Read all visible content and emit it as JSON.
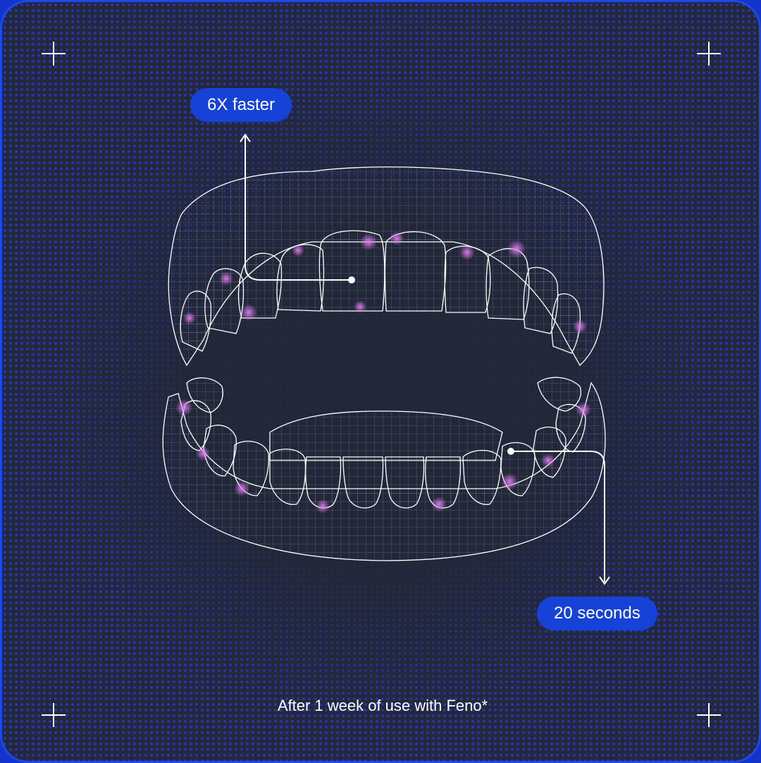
{
  "callouts": {
    "top": "6X faster",
    "bottom": "20 seconds"
  },
  "caption": "After 1 week of use with Feno*",
  "colors": {
    "accent": "#1742d8",
    "background": "#23293a",
    "line": "#ffffff",
    "highlight": "#d06adf"
  },
  "icons": [
    "plus-icon",
    "plus-icon",
    "plus-icon",
    "plus-icon"
  ]
}
